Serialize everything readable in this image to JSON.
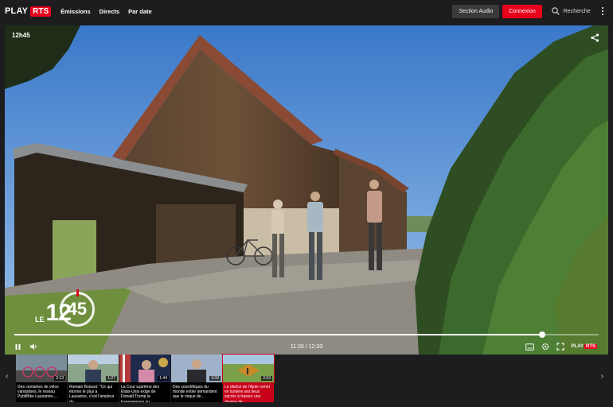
{
  "nav": {
    "logo_play": "PLAY",
    "logo_rts": "RTS",
    "items": [
      "Émissions",
      "Directs",
      "Par date"
    ],
    "audio_button": "Section Audio",
    "login_button": "Connexion",
    "search_label": "Recherche"
  },
  "player": {
    "show_name": "12h45",
    "logo_le": "LE",
    "logo_num": "12",
    "logo_ring": "45",
    "time_display": "11:20 / 12:33",
    "progress_fraction": 0.903,
    "mini_logo_play": "PLAY",
    "mini_logo_rts": "RTS"
  },
  "carousel": {
    "items": [
      {
        "title": "Des centaines de vélos vandalisés, le réseau PubliBike Lausanne-...",
        "duration": "2:13",
        "active": false
      },
      {
        "title": "Romain Boisset: \"Ce qui étonne le plus à Lausanne, c'est l'ampleur du...",
        "duration": "1:27",
        "active": false
      },
      {
        "title": "La Cour suprême des États-Unis exige de Donald Trump la transparence su...",
        "duration": "1:44",
        "active": false
      },
      {
        "title": "Des scientifiques du monde entier demandent que le risque de...",
        "duration": "2:09",
        "active": false
      },
      {
        "title": "Le district de l'Ajoie remet en lumière ses lieux sacrés à travers une dizaine de...",
        "duration": "2:03",
        "active": true
      }
    ]
  },
  "colors": {
    "accent": "#e8001c",
    "background": "#1d1d1f"
  }
}
